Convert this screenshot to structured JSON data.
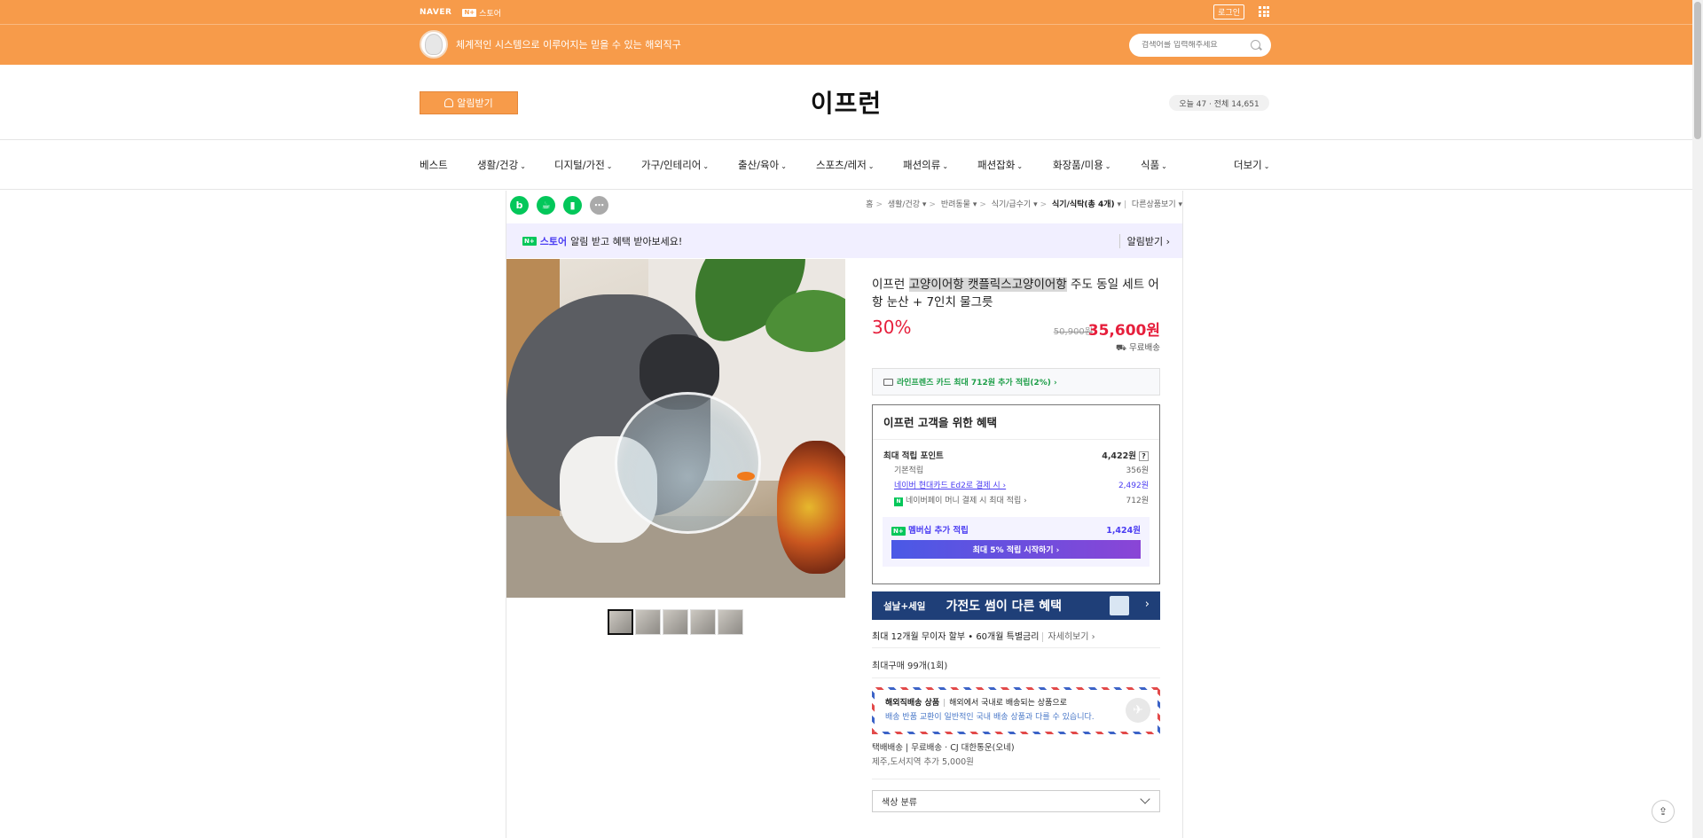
{
  "topbar": {
    "naver": "NAVER",
    "store_badge": "N+",
    "store_label": "스토어",
    "login": "로그인",
    "slogan": "체계적인 시스템으로 이루어지는 믿을 수 있는 해외직구",
    "search_placeholder": "검색어를 입력해주세요"
  },
  "store": {
    "notify": "알림받기",
    "title": "이프런",
    "visitors": "오늘 47 · 전체 14,651"
  },
  "nav": {
    "items": [
      "베스트",
      "생활/건강",
      "디지털/가전",
      "가구/인테리어",
      "출산/육아",
      "스포츠/레저",
      "패션의류",
      "패션잡화",
      "화장품/미용",
      "식품"
    ],
    "more": "더보기"
  },
  "breadcrumb": {
    "home": "홈",
    "c1": "생활/건강",
    "c2": "반려동물",
    "c3": "식기/급수기",
    "c4": "식기/식탁(총 4개)",
    "other": "다른상품보기"
  },
  "alert_band": {
    "badge": "N+",
    "store": "스토어",
    "text": "알림 받고 혜택 받아보세요!",
    "cta": "알림받기 ›"
  },
  "product": {
    "title_pre": "이프런 ",
    "title_hl": "고양이어항 캣플릭스고양이어항",
    "title_post": " 주도 동일 세트 어항 눈산 + 7인치 물그릇",
    "discount": "30%",
    "original_price": "50,900원",
    "sale_price": "35,600원",
    "shipping": "무료배송",
    "card_offer": "라인프렌즈 카드 최대 712원 추가 적립(2%) ›"
  },
  "benefits": {
    "title": "이프런 고객을 위한 혜택",
    "max_label": "최대 적립 포인트",
    "max_value": "4,422원",
    "q": "?",
    "rows": [
      {
        "label": "기본적립",
        "value": "356원"
      },
      {
        "label": "네이버 현대카드 Ed2로 결제 시 ›",
        "value": "2,492원"
      },
      {
        "label": "네이버페이 머니 결제 시 최대 적립 ›",
        "value": "712원"
      }
    ],
    "npay_badge": "N",
    "member_badge": "N+",
    "member_label": "멤버십 추가 적립",
    "member_value": "1,424원",
    "start_btn": "최대 5% 적립 시작하기 ›"
  },
  "banner": {
    "small": "설날+세일",
    "big": "가전도 썸이 다른 혜택",
    "arrow": "›"
  },
  "installment": {
    "text": "최대 12개월 무이자 할부 • 60개월 특별금리",
    "more": "자세히보기 ›"
  },
  "max_purchase": "최대구매 99개(1회)",
  "overseas": {
    "title": "해외직배송 상품",
    "desc": "해외에서 국내로 배송되는 상품으로",
    "line2": "배송 반품 교환이 일반적인 국내 배송 상품과 다를 수 있습니다."
  },
  "delivery": {
    "line1": "택배배송 | 무료배송 · CJ 대한통운(오네)",
    "line2": "제주,도서지역 추가 5,000원"
  },
  "option": {
    "label": "색상 분류"
  },
  "share": {
    "blog": "b",
    "float": "⇪"
  }
}
